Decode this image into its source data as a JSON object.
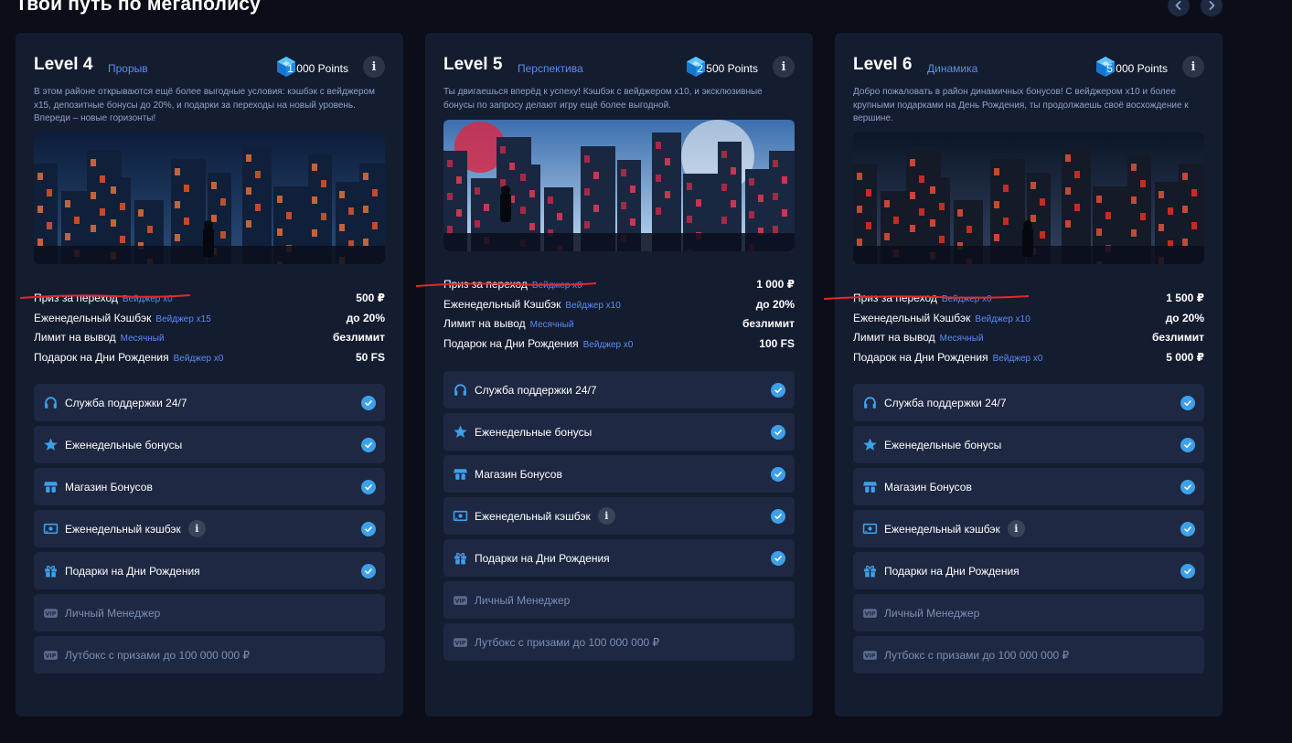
{
  "page": {
    "title": "Твои путь по мегаполису"
  },
  "colors": {
    "accent": "#3da0ea",
    "tag_blue": "#5a8ef0",
    "card_bg": "#141c30",
    "row_bg": "#1e2842",
    "annotation_red": "#e8262a"
  },
  "levels": [
    {
      "name": "Level 4",
      "subtitle": "Прорыв",
      "points": "1 000 Points",
      "description": "В этом районе открываются ещё более выгодные условия: кэшбэк с вейджером x15, депозитные бонусы до 20%, и подарки за переходы на новый уровень. Впереди – новые горизонты!",
      "stats": [
        {
          "label": "Приз за переход",
          "tag": "Вейджер x0",
          "value": "500 ₽"
        },
        {
          "label": "Еженедельный Кэшбэк",
          "tag": "Вейджер x15",
          "value": "до 20%"
        },
        {
          "label": "Лимит на вывод",
          "tag": "Месячный",
          "value": "безлимит"
        },
        {
          "label": "Подарок на Дни Рождения",
          "tag": "Вейджер x0",
          "value": "50 FS"
        }
      ],
      "features": [
        {
          "label": "Служба поддержки 24/7",
          "icon": "headset-icon",
          "enabled": true
        },
        {
          "label": "Еженедельные бонусы",
          "icon": "star-icon",
          "enabled": true
        },
        {
          "label": "Магазин Бонусов",
          "icon": "shop-icon",
          "enabled": true
        },
        {
          "label": "Еженедельный кэшбэк",
          "icon": "cash-icon",
          "enabled": true,
          "info": "i"
        },
        {
          "label": "Подарки на Дни Рождения",
          "icon": "gift-icon",
          "enabled": true
        },
        {
          "label": "Личный Менеджер",
          "icon": "vip-icon",
          "enabled": false
        },
        {
          "label": "Лутбокс с призами до 100 000 000 ₽",
          "icon": "vip-icon",
          "enabled": false
        }
      ]
    },
    {
      "name": "Level 5",
      "subtitle": "Перспектива",
      "points": "2 500 Points",
      "description": "Ты двигаешься вперёд к успеху! Кэшбэк с вейджером x10, и эксклюзивные бонусы по запросу делают игру ещё более выгодной.",
      "stats": [
        {
          "label": "Приз за переход",
          "tag": "Вейджер x0",
          "value": "1 000 ₽"
        },
        {
          "label": "Еженедельный Кэшбэк",
          "tag": "Вейджер x10",
          "value": "до 20%"
        },
        {
          "label": "Лимит на вывод",
          "tag": "Месячный",
          "value": "безлимит"
        },
        {
          "label": "Подарок на Дни Рождения",
          "tag": "Вейджер x0",
          "value": "100 FS"
        }
      ],
      "features": [
        {
          "label": "Служба поддержки 24/7",
          "icon": "headset-icon",
          "enabled": true
        },
        {
          "label": "Еженедельные бонусы",
          "icon": "star-icon",
          "enabled": true
        },
        {
          "label": "Магазин Бонусов",
          "icon": "shop-icon",
          "enabled": true
        },
        {
          "label": "Еженедельный кэшбэк",
          "icon": "cash-icon",
          "enabled": true,
          "info": "i"
        },
        {
          "label": "Подарки на Дни Рождения",
          "icon": "gift-icon",
          "enabled": true
        },
        {
          "label": "Личный Менеджер",
          "icon": "vip-icon",
          "enabled": false
        },
        {
          "label": "Лутбокс с призами до 100 000 000 ₽",
          "icon": "vip-icon",
          "enabled": false
        }
      ]
    },
    {
      "name": "Level 6",
      "subtitle": "Динамика",
      "points": "5 000 Points",
      "description": "Добро пожаловать в район динамичных бонусов! С вейджером x10 и более крупными подарками на День Рождения, ты продолжаешь своё восхождение к вершине.",
      "stats": [
        {
          "label": "Приз за переход",
          "tag": "Вейджер x0",
          "value": "1 500 ₽"
        },
        {
          "label": "Еженедельный Кэшбэк",
          "tag": "Вейджер x10",
          "value": "до 20%"
        },
        {
          "label": "Лимит на вывод",
          "tag": "Месячный",
          "value": "безлимит"
        },
        {
          "label": "Подарок на Дни Рождения",
          "tag": "Вейджер x0",
          "value": "5 000 ₽"
        }
      ],
      "features": [
        {
          "label": "Служба поддержки 24/7",
          "icon": "headset-icon",
          "enabled": true
        },
        {
          "label": "Еженедельные бонусы",
          "icon": "star-icon",
          "enabled": true
        },
        {
          "label": "Магазин Бонусов",
          "icon": "shop-icon",
          "enabled": true
        },
        {
          "label": "Еженедельный кэшбэк",
          "icon": "cash-icon",
          "enabled": true,
          "info": "i"
        },
        {
          "label": "Подарки на Дни Рождения",
          "icon": "gift-icon",
          "enabled": true
        },
        {
          "label": "Личный Менеджер",
          "icon": "vip-icon",
          "enabled": false
        },
        {
          "label": "Лутбокс с призами до 100 000 000 ₽",
          "icon": "vip-icon",
          "enabled": false
        }
      ]
    }
  ]
}
